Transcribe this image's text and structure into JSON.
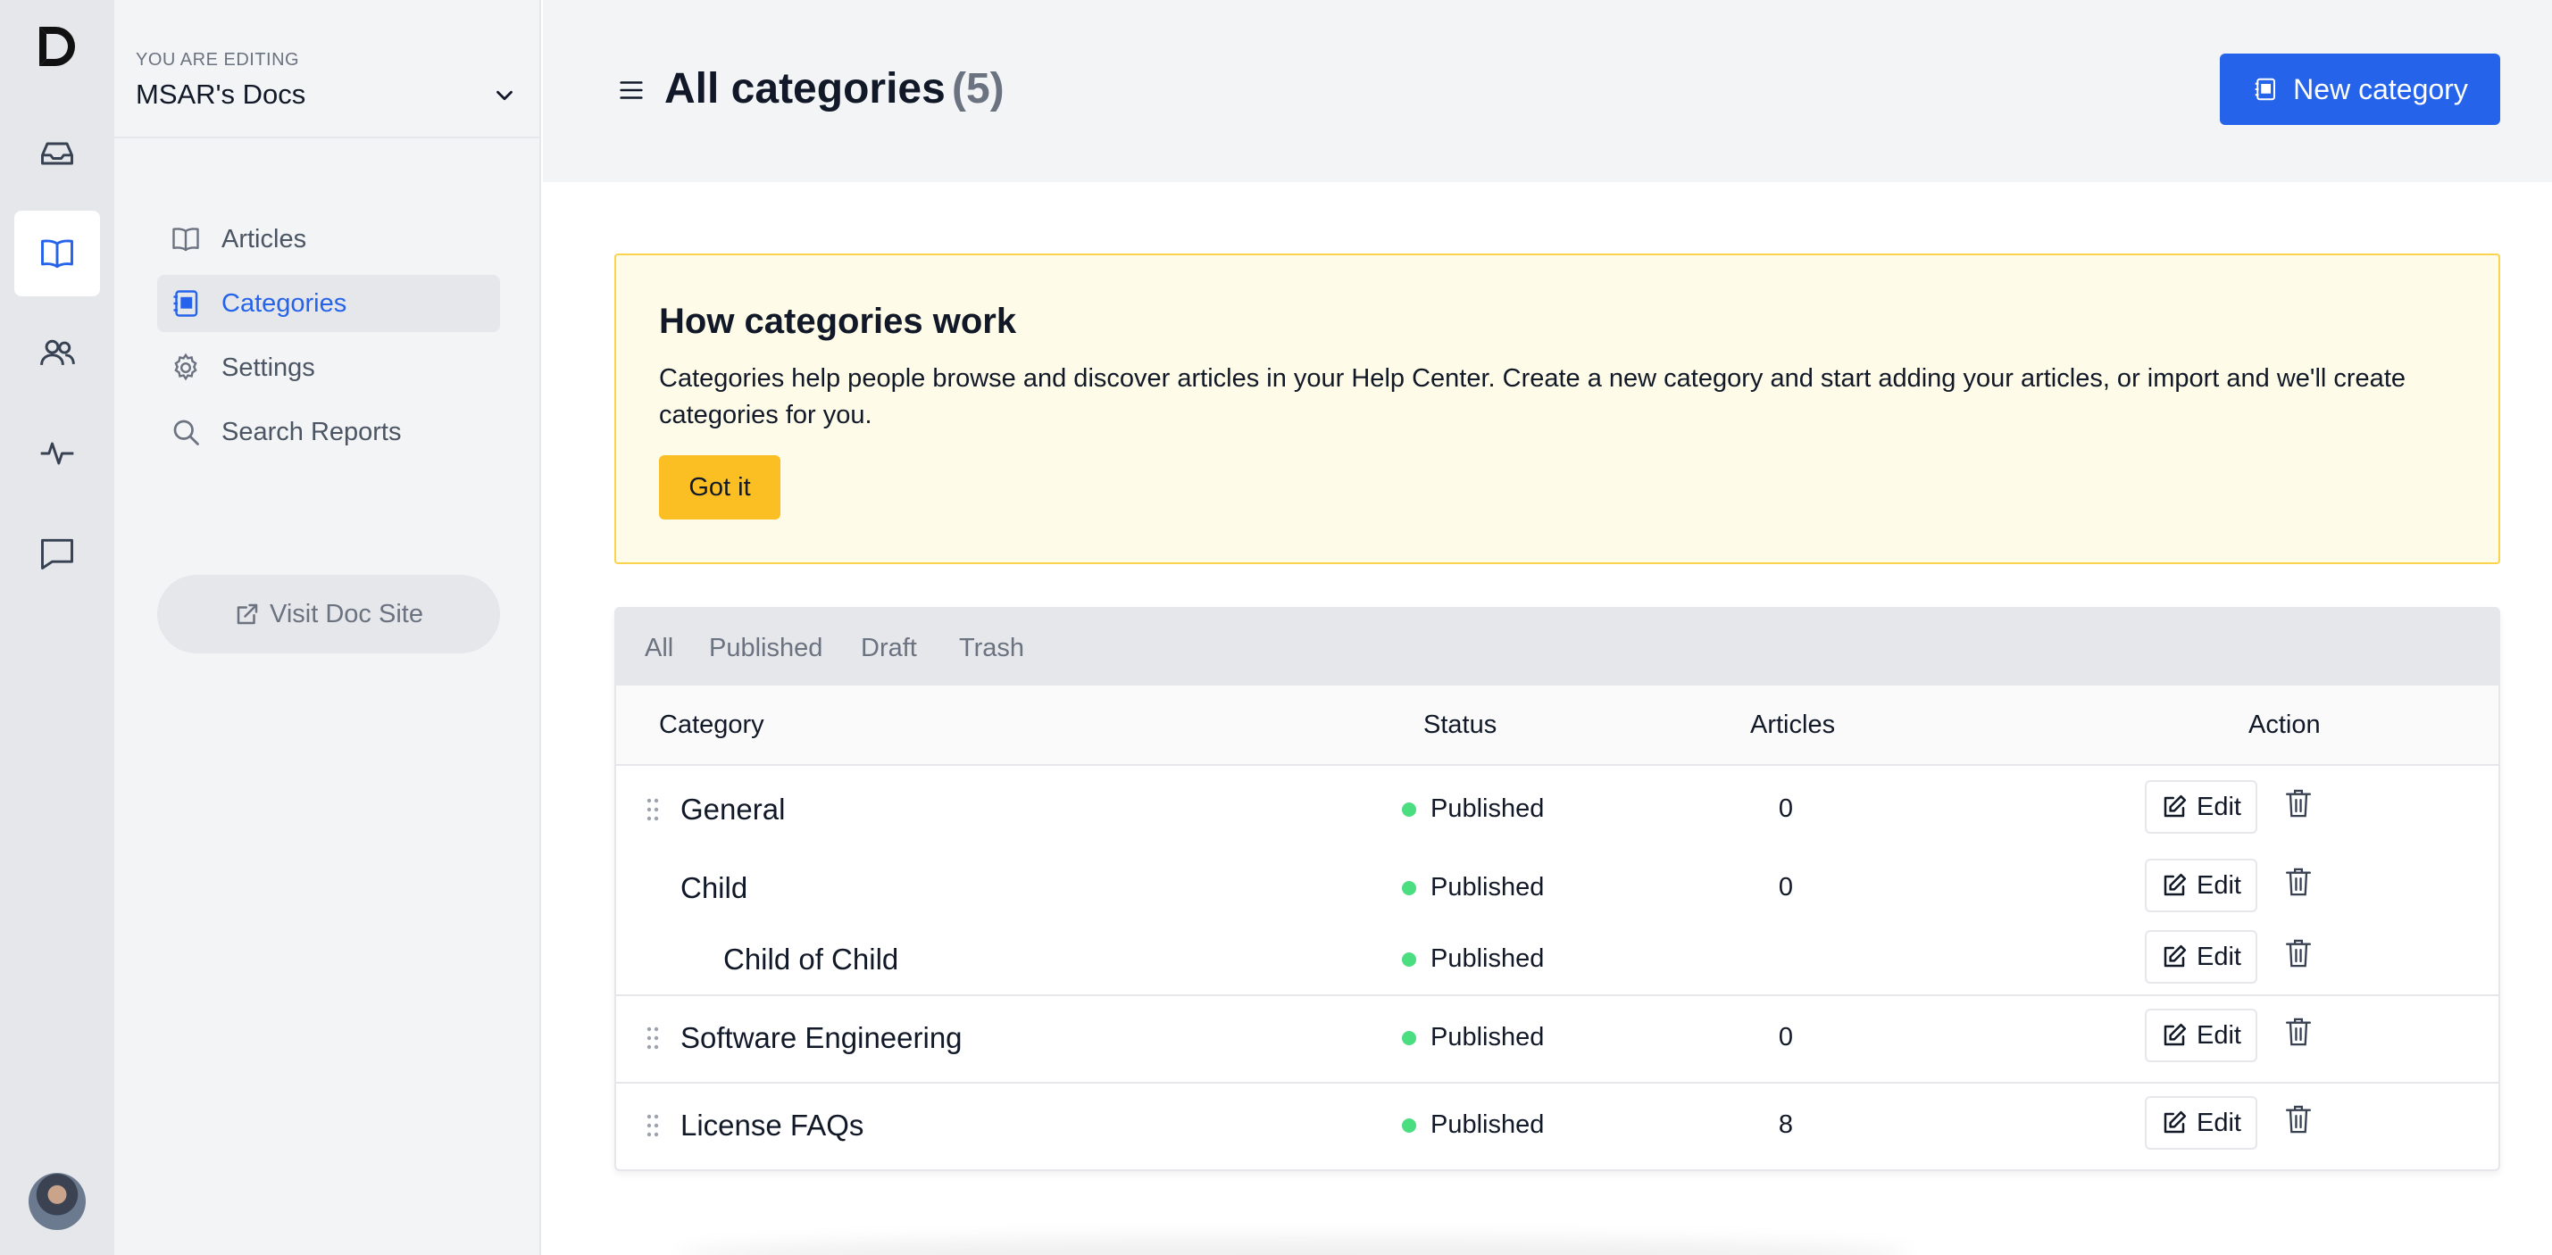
{
  "sidebar": {
    "editing_label": "YOU ARE EDITING",
    "site_name": "MSAR's Docs",
    "nav": [
      {
        "label": "Articles",
        "icon": "book-open-icon",
        "active": false
      },
      {
        "label": "Categories",
        "icon": "categories-icon",
        "active": true
      },
      {
        "label": "Settings",
        "icon": "gear-icon",
        "active": false
      },
      {
        "label": "Search Reports",
        "icon": "search-icon",
        "active": false
      }
    ],
    "visit_label": "Visit Doc Site"
  },
  "rail": {
    "items": [
      "logo-icon",
      "inbox-icon",
      "book-open-icon",
      "users-icon",
      "activity-icon",
      "chat-icon",
      "avatar"
    ]
  },
  "header": {
    "title": "All categories",
    "count": "(5)",
    "new_button": "New category"
  },
  "info": {
    "title": "How categories work",
    "body": "Categories help people browse and discover articles in your Help Center. Create a new category and start adding your articles, or import and we'll create categories for you.",
    "button": "Got it"
  },
  "table": {
    "tabs": [
      "All",
      "Published",
      "Draft",
      "Trash"
    ],
    "columns": {
      "category": "Category",
      "status": "Status",
      "articles": "Articles",
      "action": "Action"
    },
    "rows": [
      {
        "name": "General",
        "status": "Published",
        "articles": "0",
        "edit": "Edit"
      },
      {
        "name": "Child",
        "status": "Published",
        "articles": "0",
        "edit": "Edit"
      },
      {
        "name": "Child of Child",
        "status": "Published",
        "articles": "",
        "edit": "Edit"
      },
      {
        "name": "Software Engineering",
        "status": "Published",
        "articles": "0",
        "edit": "Edit"
      },
      {
        "name": "License FAQs",
        "status": "Published",
        "articles": "8",
        "edit": "Edit"
      }
    ]
  },
  "colors": {
    "accent": "#2563eb",
    "warning_bg": "#fefbe8",
    "warning_border": "#fcd34d",
    "button_yellow": "#fbbf24",
    "status_green": "#4ade80"
  }
}
